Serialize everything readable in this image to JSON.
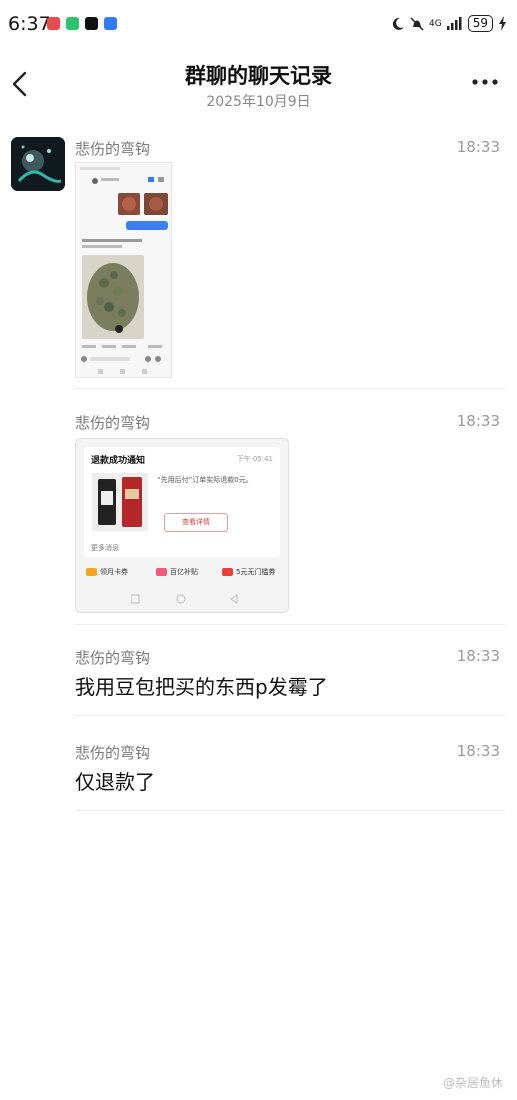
{
  "status_bar": {
    "time": "6:37",
    "signal_label": "4G",
    "battery": "59",
    "app_icons": [
      "red-app-icon",
      "wechat-icon",
      "tiktok-icon",
      "blue-app-icon"
    ],
    "app_icon_colors": [
      "#e84b4b",
      "#2dc26b",
      "#111111",
      "#2f7cf6"
    ]
  },
  "header": {
    "title": "群聊的聊天记录",
    "date": "2025年10月9日"
  },
  "messages": [
    {
      "sender": "悲伤的弯钩",
      "time": "18:33",
      "type": "image",
      "image_desc": "chat screenshot with jar of moldy food"
    },
    {
      "sender": "悲伤的弯钩",
      "time": "18:33",
      "type": "image",
      "card": {
        "title": "退款成功通知",
        "time": "下午 05:41",
        "desc": "“先用后付”订单实际退款0元。",
        "button": "查看详情",
        "more": "更多消息",
        "coupons": [
          "领月卡券",
          "百亿补贴",
          "5元无门槛券"
        ]
      }
    },
    {
      "sender": "悲伤的弯钩",
      "time": "18:33",
      "type": "text",
      "text": "我用豆包把买的东西p发霉了"
    },
    {
      "sender": "悲伤的弯钩",
      "time": "18:33",
      "type": "text",
      "text": "仅退款了"
    }
  ],
  "watermark": "@杂居鱼休"
}
